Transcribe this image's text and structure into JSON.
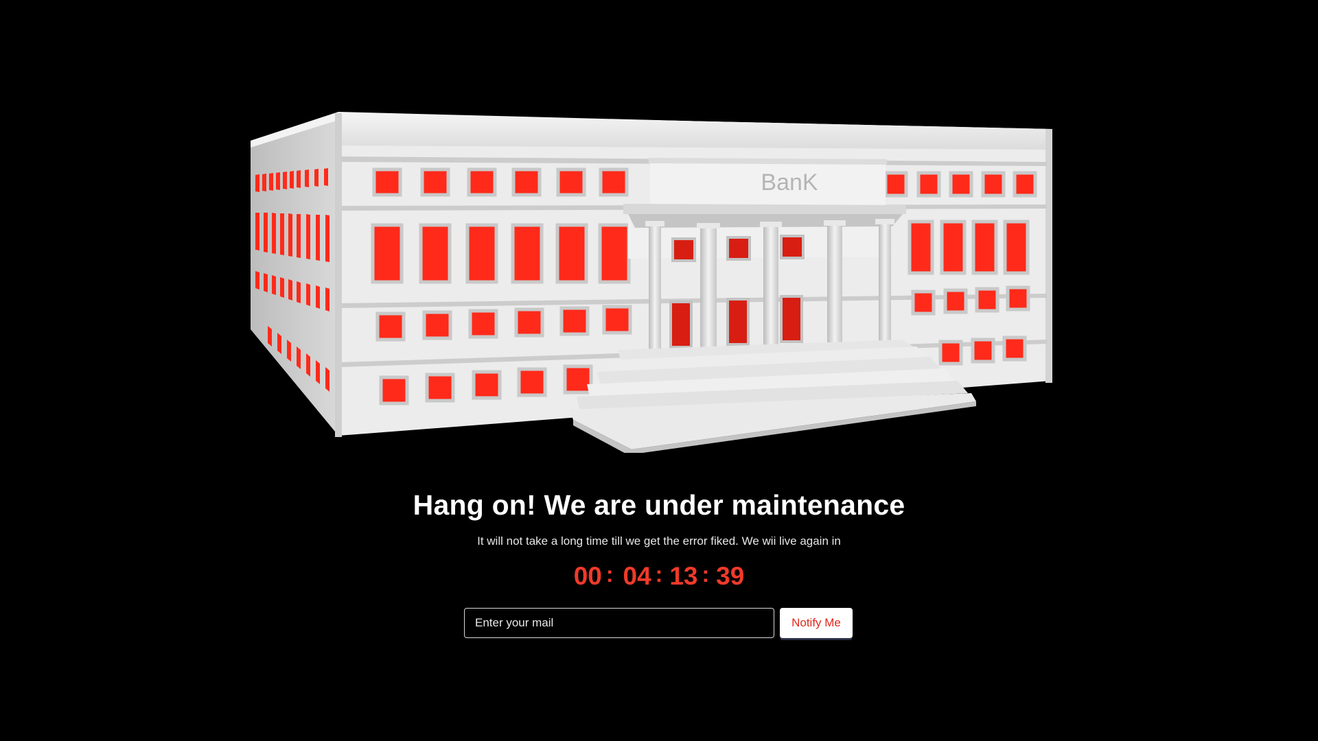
{
  "illustration": {
    "sign_text": "BanK",
    "wall_color": "#eeeeee",
    "window_color": "#ff2a1a"
  },
  "heading": "Hang on! We are under maintenance",
  "subheading": "It will not take a long time till we get the error fiked. We wii live again in",
  "countdown": {
    "days": "00",
    "hours": "04",
    "minutes": "13",
    "seconds": "39",
    "color": "#f03a2a"
  },
  "form": {
    "email_placeholder": "Enter your mail",
    "email_value": "",
    "button_label": "Notify Me"
  }
}
